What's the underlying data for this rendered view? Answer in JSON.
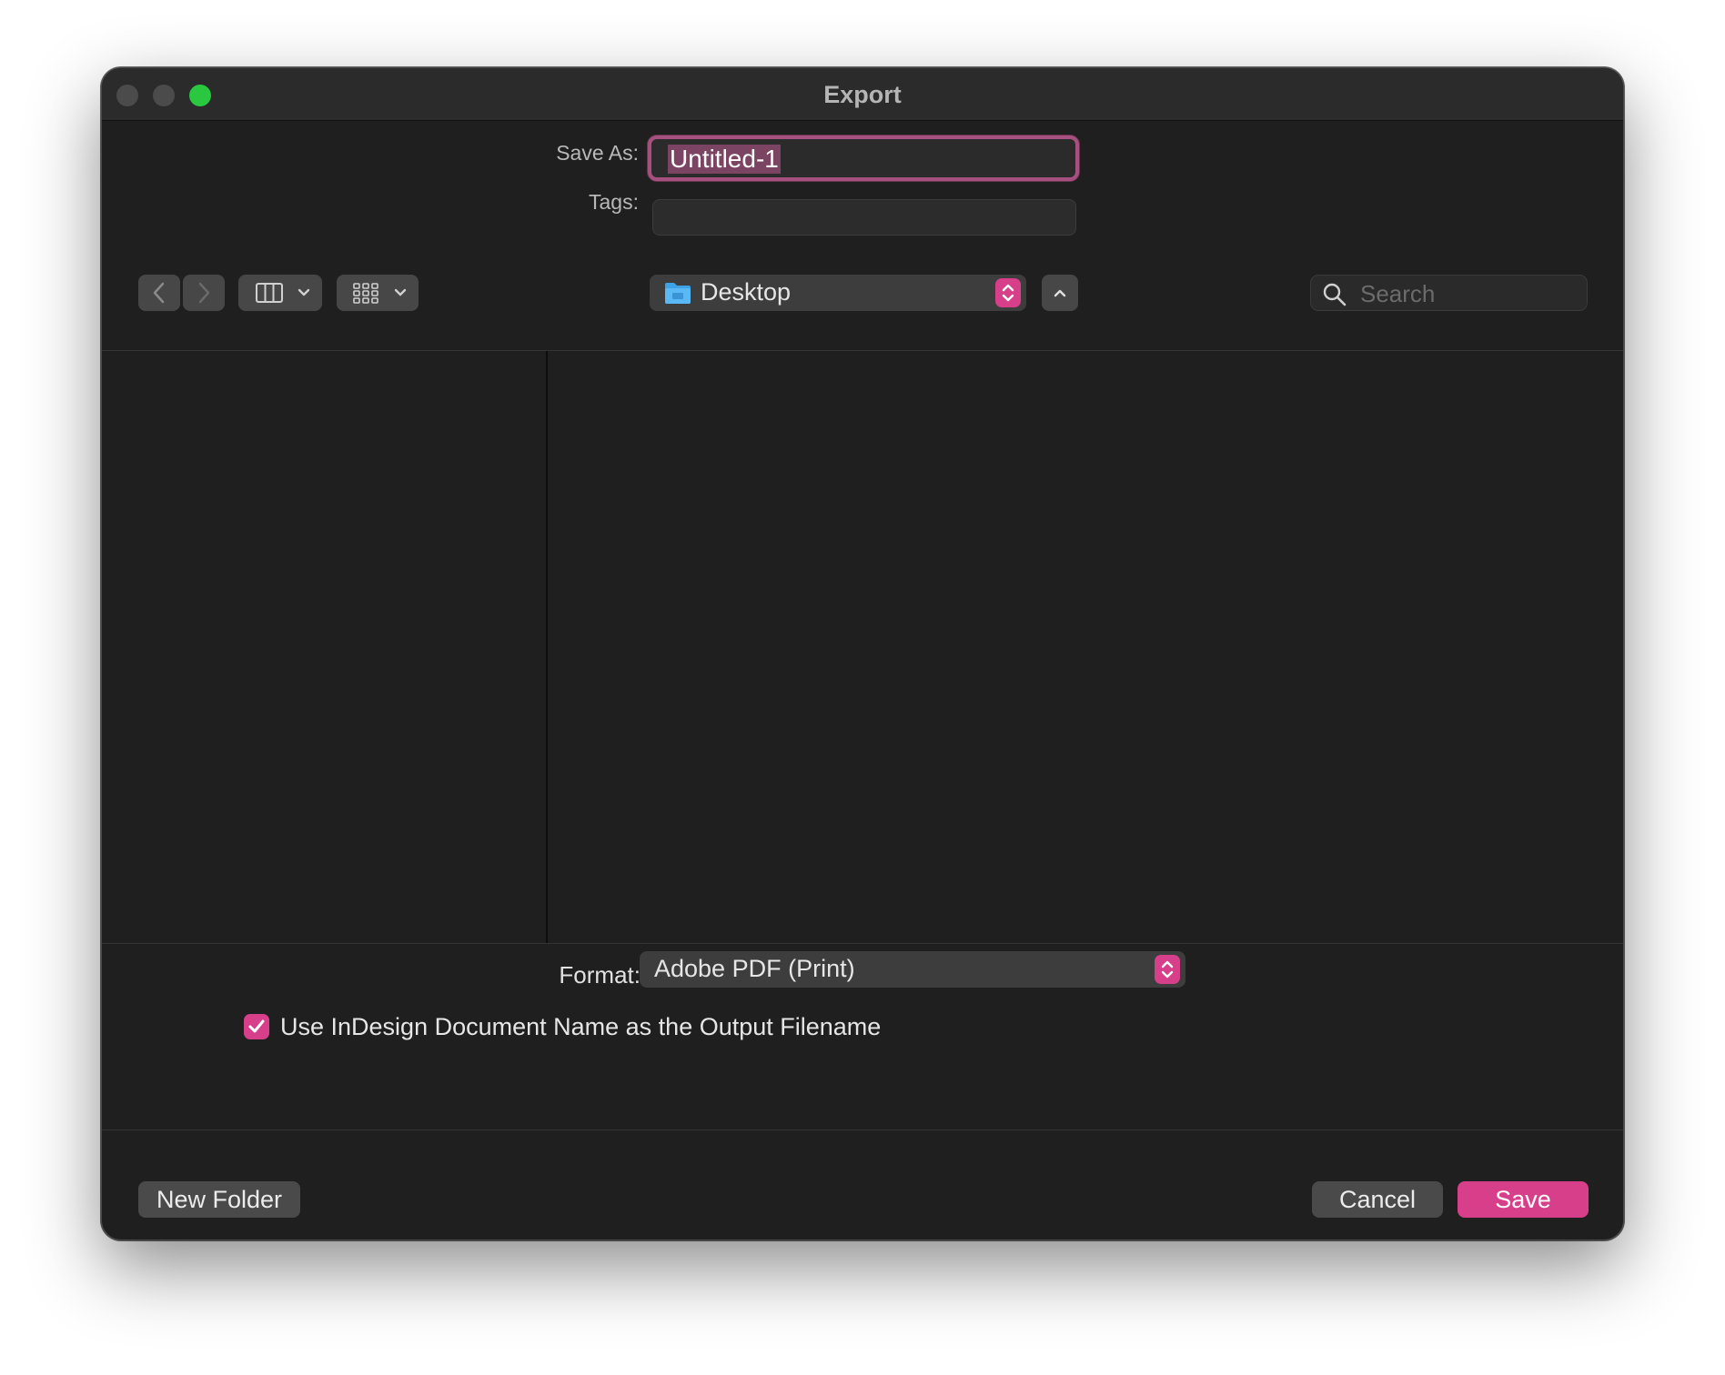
{
  "window": {
    "title": "Export"
  },
  "save_as": {
    "label": "Save As:",
    "value": "Untitled-1"
  },
  "tags": {
    "label": "Tags:",
    "value": ""
  },
  "toolbar": {
    "back_icon": "chevron-left-icon",
    "forward_icon": "chevron-right-icon",
    "view_icon": "columns-icon",
    "group_icon": "grid-icon",
    "collapse_icon": "chevron-up-icon"
  },
  "location": {
    "value": "Desktop",
    "icon": "folder-icon"
  },
  "search": {
    "placeholder": "Search"
  },
  "format": {
    "label": "Format:",
    "value": "Adobe PDF (Print)"
  },
  "options": {
    "use_doc_name_label": "Use InDesign Document Name as the Output Filename",
    "use_doc_name_checked": true
  },
  "buttons": {
    "new_folder": "New Folder",
    "cancel": "Cancel",
    "save": "Save"
  },
  "colors": {
    "accent": "#d73f8a",
    "focus_ring": "#a5507e",
    "window_bg": "#1f1f1f"
  }
}
